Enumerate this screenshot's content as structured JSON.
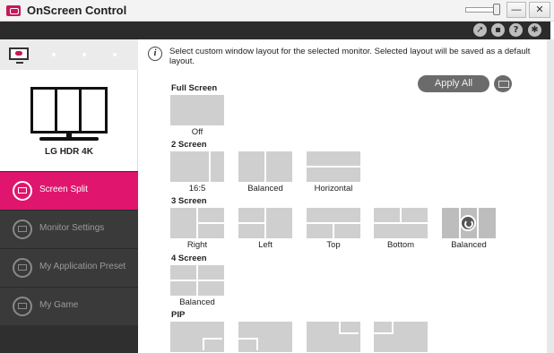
{
  "window": {
    "title": "OnScreen Control",
    "controls": {
      "minimize": "—",
      "maximize": "□",
      "close": "✕"
    }
  },
  "toolbar": {
    "icons": [
      "cursor-icon",
      "monitor-icon",
      "help-icon",
      "settings-icon"
    ],
    "help_glyph": "?"
  },
  "sidebar": {
    "monitor_name": "LG HDR 4K",
    "menu": [
      {
        "label": "Screen Split",
        "active": true
      },
      {
        "label": "Monitor Settings",
        "active": false
      },
      {
        "label": "My Application Preset",
        "active": false
      },
      {
        "label": "My Game",
        "active": false
      }
    ]
  },
  "main": {
    "info_glyph": "i",
    "info_text": "Select custom window layout for the selected monitor. Selected layout will be saved as a default layout.",
    "apply_all_label": "Apply All",
    "sections": {
      "full_screen": {
        "title": "Full Screen",
        "layouts": [
          {
            "label": "Off"
          }
        ]
      },
      "two_screen": {
        "title": "2 Screen",
        "layouts": [
          {
            "label": "16:5"
          },
          {
            "label": "Balanced"
          },
          {
            "label": "Horizontal"
          }
        ]
      },
      "three_screen": {
        "title": "3 Screen",
        "layouts": [
          {
            "label": "Right"
          },
          {
            "label": "Left"
          },
          {
            "label": "Top"
          },
          {
            "label": "Bottom"
          },
          {
            "label": "Balanced",
            "selected": true
          }
        ]
      },
      "four_screen": {
        "title": "4 Screen",
        "layouts": [
          {
            "label": "Balanced"
          }
        ]
      },
      "pip": {
        "title": "PIP"
      }
    }
  },
  "colors": {
    "accent": "#e0156e",
    "sidebar_bg": "#2f2f2f",
    "toolbar_bg": "#2b2b2b",
    "tile": "#cfcfcf"
  }
}
